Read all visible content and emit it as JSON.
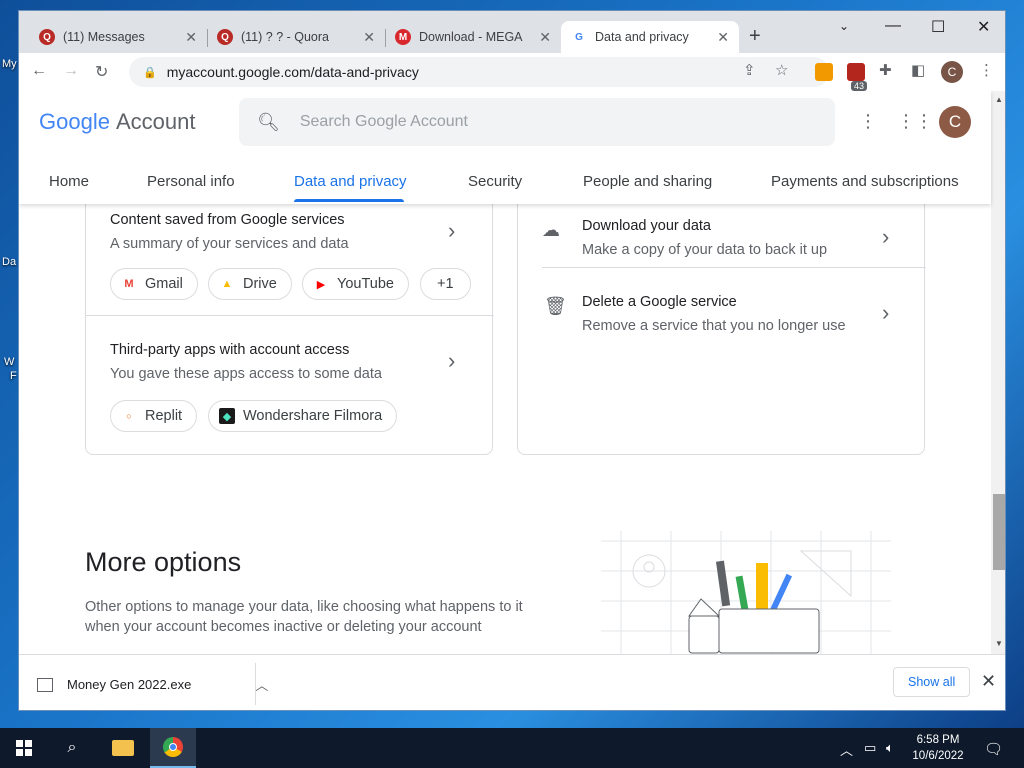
{
  "desktop": {
    "frag1": "My",
    "frag2": "Da",
    "frag3": "W",
    "frag4": "F"
  },
  "browser": {
    "tabs": [
      {
        "title": "(11) Messages",
        "favicon": "quora-icon"
      },
      {
        "title": "(11) ? ? - Quora",
        "favicon": "quora-icon"
      },
      {
        "title": "Download - MEGA",
        "favicon": "mega-icon"
      },
      {
        "title": "Data and privacy",
        "favicon": "google-icon"
      }
    ],
    "url": "myaccount.google.com/data-and-privacy",
    "extension_badge": "43",
    "profile_letter": "C"
  },
  "account": {
    "logo_google": "Google",
    "logo_account": "Account",
    "search_placeholder": "Search Google Account",
    "avatar_letter": "C",
    "nav": [
      "Home",
      "Personal info",
      "Data and privacy",
      "Security",
      "People and sharing",
      "Payments and subscriptions"
    ],
    "active_nav": "Data and privacy"
  },
  "left_card": {
    "content_saved": {
      "title": "Content saved from Google services",
      "subtitle": "A summary of your services and data"
    },
    "service_chips": [
      "Gmail",
      "Drive",
      "YouTube",
      "+1"
    ],
    "third_party": {
      "title": "Third-party apps with account access",
      "subtitle": "You gave these apps access to some data"
    },
    "app_chips": [
      "Replit",
      "Wondershare Filmora"
    ]
  },
  "right_card": {
    "download": {
      "title": "Download your data",
      "subtitle": "Make a copy of your data to back it up"
    },
    "delete": {
      "title": "Delete a Google service",
      "subtitle": "Remove a service that you no longer use"
    }
  },
  "more_options": {
    "title": "More options",
    "description": "Other options to manage your data, like choosing what happens to it when your account becomes inactive or deleting your account"
  },
  "download_shelf": {
    "file_name": "Money Gen 2022.exe",
    "show_all": "Show all"
  },
  "taskbar": {
    "time": "6:58 PM",
    "date": "10/6/2022"
  }
}
